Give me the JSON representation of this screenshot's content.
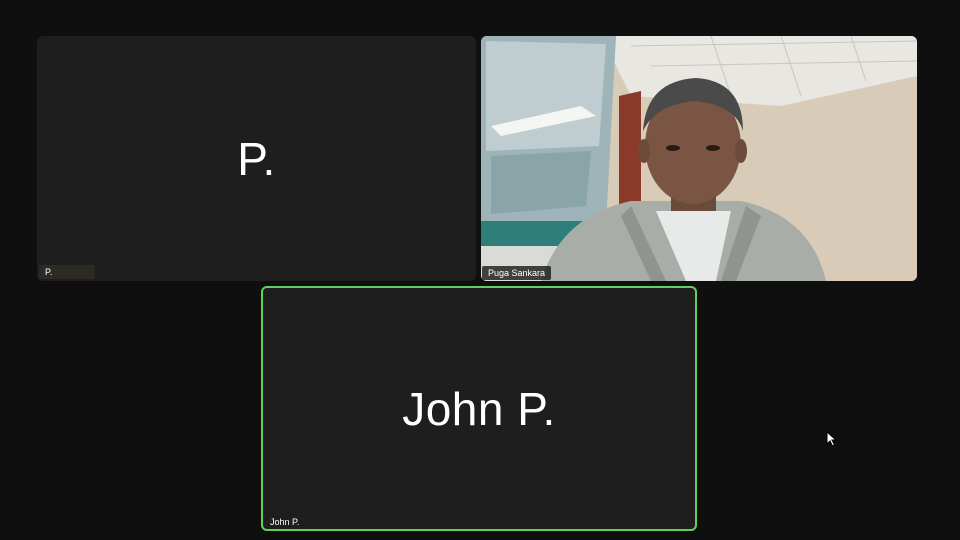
{
  "tiles": {
    "top_left": {
      "display_name": "P.",
      "name_tag": "P."
    },
    "top_right": {
      "name_tag": "Puga Sankara"
    },
    "bottom": {
      "display_name": "John P.",
      "name_tag": "John P.",
      "active_speaker_border_color": "#5ed15f"
    }
  },
  "icons": {
    "cursor": "mouse-pointer-icon"
  }
}
